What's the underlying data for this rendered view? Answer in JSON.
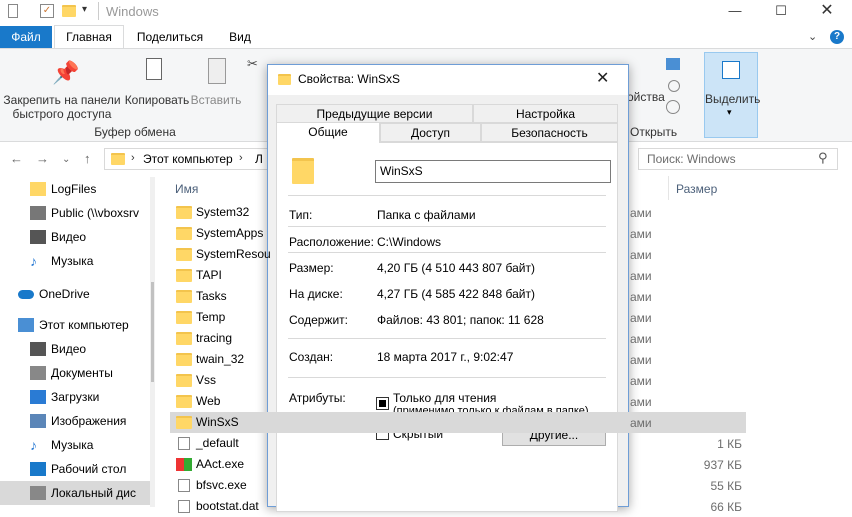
{
  "window": {
    "title": "Windows"
  },
  "ribbon": {
    "tabs": [
      "Файл",
      "Главная",
      "Поделиться",
      "Вид"
    ],
    "pin_label_1": "Закрепить на панели",
    "pin_label_2": "быстрого доступа",
    "copy_label": "Копировать",
    "paste_label": "Вставить",
    "group_clipboard": "Буфер обмена",
    "properties_partial": "ойства",
    "open_label": "Открыть",
    "select_label": "Выделить"
  },
  "address": {
    "crumb_root": "Этот компьютер",
    "crumb_next": "Л",
    "search_placeholder": "Поиск: Windows"
  },
  "nav": [
    {
      "label": "LogFiles",
      "icon": "folder-icon"
    },
    {
      "label": "Public (\\\\vboxsrv",
      "icon": "network-drive-icon"
    },
    {
      "label": "Видео",
      "icon": "video-icon"
    },
    {
      "label": "Музыка",
      "icon": "music-icon"
    },
    {
      "label": "OneDrive",
      "icon": "onedrive-icon"
    },
    {
      "label": "Этот компьютер",
      "icon": "computer-icon"
    },
    {
      "label": "Видео",
      "icon": "video-icon"
    },
    {
      "label": "Документы",
      "icon": "documents-icon"
    },
    {
      "label": "Загрузки",
      "icon": "downloads-icon"
    },
    {
      "label": "Изображения",
      "icon": "pictures-icon"
    },
    {
      "label": "Музыка",
      "icon": "music-icon"
    },
    {
      "label": "Рабочий стол",
      "icon": "desktop-icon"
    },
    {
      "label": "Локальный дис",
      "icon": "local-disk-icon"
    }
  ],
  "list": {
    "col_name": "Имя",
    "col_size": "Размер",
    "rows": [
      {
        "name": "System32",
        "type": "ами",
        "size": ""
      },
      {
        "name": "SystemApps",
        "type": "ами",
        "size": ""
      },
      {
        "name": "SystemResou",
        "type": "ами",
        "size": ""
      },
      {
        "name": "TAPI",
        "type": "ами",
        "size": ""
      },
      {
        "name": "Tasks",
        "type": "ами",
        "size": ""
      },
      {
        "name": "Temp",
        "type": "ами",
        "size": ""
      },
      {
        "name": "tracing",
        "type": "ами",
        "size": ""
      },
      {
        "name": "twain_32",
        "type": "ами",
        "size": ""
      },
      {
        "name": "Vss",
        "type": "ами",
        "size": ""
      },
      {
        "name": "Web",
        "type": "ами",
        "size": ""
      },
      {
        "name": "WinSxS",
        "type": "ами",
        "size": ""
      },
      {
        "name": "_default",
        "type": "",
        "size": "1 КБ"
      },
      {
        "name": "AAct.exe",
        "type": "",
        "size": "937 КБ"
      },
      {
        "name": "bfsvc.exe",
        "type": "",
        "size": "55 КБ"
      },
      {
        "name": "bootstat.dat",
        "type": "",
        "size": "66 КБ"
      }
    ]
  },
  "dialog": {
    "title": "Свойства: WinSxS",
    "tabs_top": [
      "Предыдущие версии",
      "Настройка"
    ],
    "tabs_bottom": [
      "Общие",
      "Доступ",
      "Безопасность"
    ],
    "name_value": "WinSxS",
    "type_label": "Тип:",
    "type_value": "Папка с файлами",
    "location_label": "Расположение:",
    "location_value": "C:\\Windows",
    "size_label": "Размер:",
    "size_value": "4,20 ГБ (4 510 443 807 байт)",
    "ondisk_label": "На диске:",
    "ondisk_value": "4,27 ГБ (4 585 422 848 байт)",
    "contains_label": "Содержит:",
    "contains_value": "Файлов: 43 801; папок: 11 628",
    "created_label": "Создан:",
    "created_value": "18 марта 2017 г., 9:02:47",
    "attributes_label": "Атрибуты:",
    "readonly_label": "Только для чтения",
    "readonly_hint": "(применимо только к файлам в папке)",
    "hidden_label": "Скрытый",
    "other_button": "Другие..."
  },
  "colors": {
    "accent": "#1979ca",
    "folder": "#ffd766",
    "selection": "#d9d9d9"
  }
}
